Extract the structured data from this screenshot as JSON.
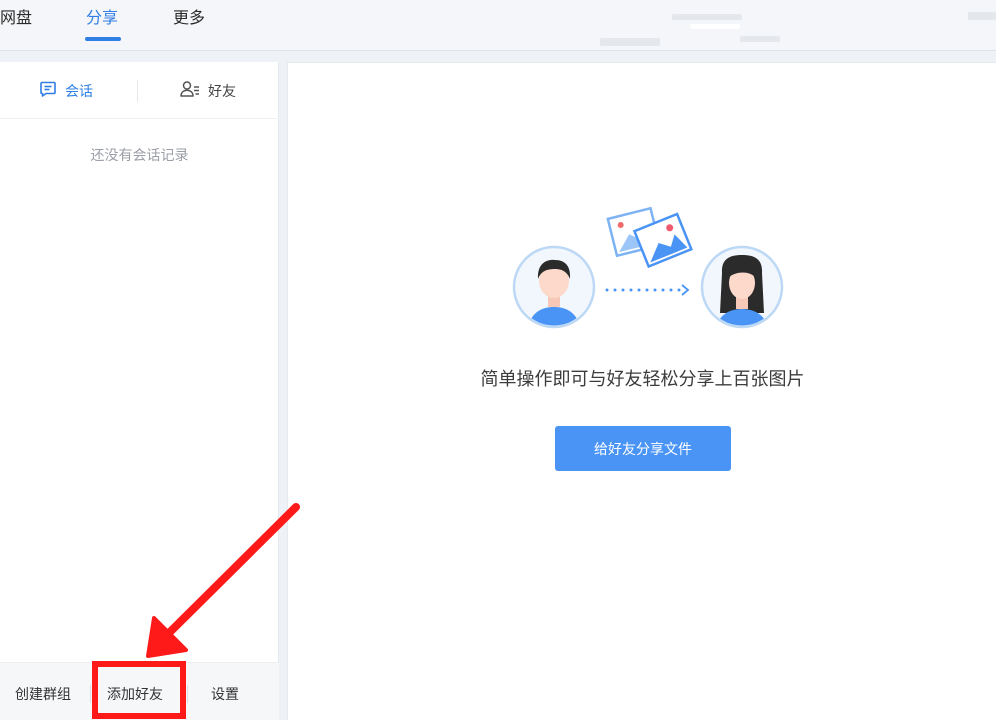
{
  "nav": {
    "tabs": [
      {
        "label": "网盘",
        "active": false
      },
      {
        "label": "分享",
        "active": true
      },
      {
        "label": "更多",
        "active": false
      }
    ]
  },
  "colors": {
    "accent": "#2f7fe6",
    "button": "#4a94f5",
    "annotation": "#ff1a1a"
  },
  "sidebar": {
    "tabs": [
      {
        "label": "会话",
        "icon": "chat-icon",
        "active": true
      },
      {
        "label": "好友",
        "icon": "contacts-icon",
        "active": false
      }
    ],
    "empty_text": "还没有会话记录",
    "footer": {
      "create_group": "创建群组",
      "add_friend": "添加好友",
      "settings": "设置"
    }
  },
  "main": {
    "illustration": "share-photos-illustration",
    "tagline": "简单操作即可与好友轻松分享上百张图片",
    "share_button": "给好友分享文件"
  }
}
